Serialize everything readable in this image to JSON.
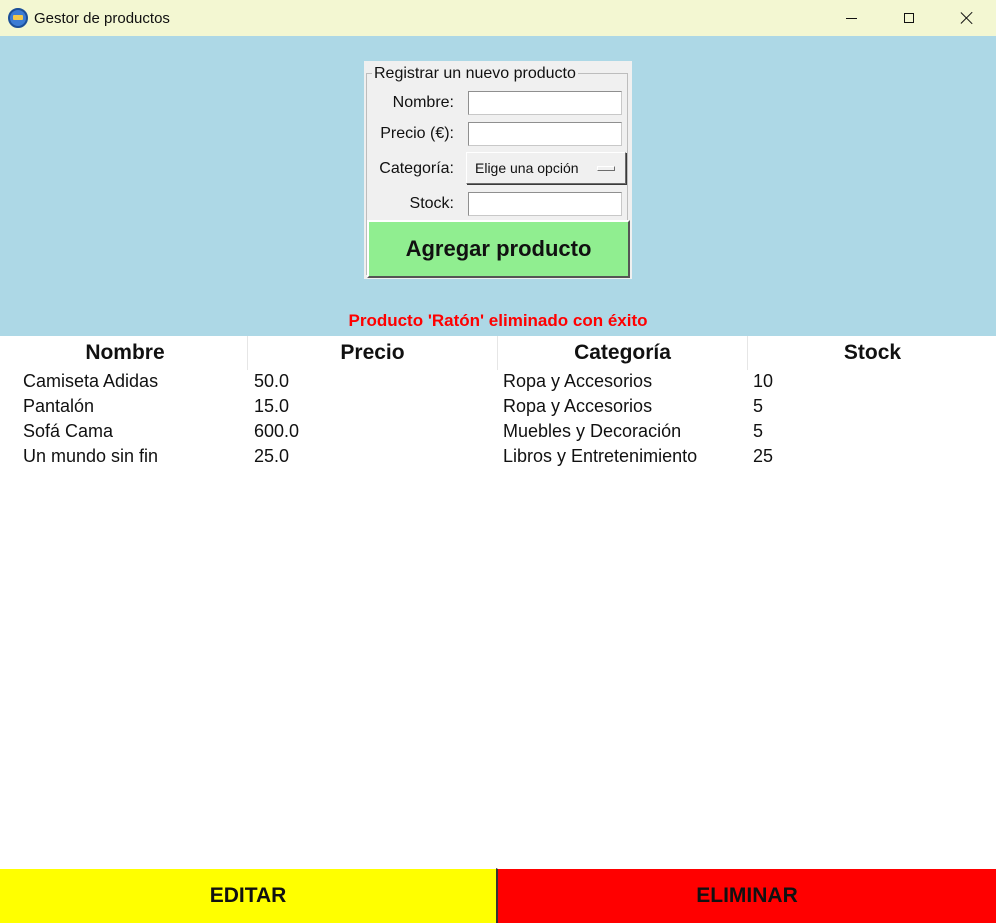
{
  "window": {
    "title": "Gestor de productos",
    "icon": "app-icon"
  },
  "form": {
    "legend": "Registrar un nuevo producto",
    "labels": {
      "nombre": "Nombre:",
      "precio": "Precio (€):",
      "categoria": "Categoría:",
      "stock": "Stock:"
    },
    "values": {
      "nombre": "",
      "precio": "",
      "stock": ""
    },
    "categoria_selected": "Elige una opción",
    "add_button": "Agregar producto"
  },
  "status": {
    "message": "Producto 'Ratón' eliminado con éxito",
    "color": "#ff0000"
  },
  "table": {
    "headers": [
      "Nombre",
      "Precio",
      "Categoría",
      "Stock"
    ],
    "rows": [
      [
        "Camiseta Adidas",
        "50.0",
        "Ropa y Accesorios",
        "10"
      ],
      [
        "Pantalón",
        "15.0",
        "Ropa y Accesorios",
        "5"
      ],
      [
        "Sofá Cama",
        "600.0",
        "Muebles y Decoración",
        "5"
      ],
      [
        "Un mundo sin fin",
        "25.0",
        "Libros y Entretenimiento",
        "25"
      ]
    ]
  },
  "actions": {
    "edit": "EDITAR",
    "delete": "ELIMINAR"
  },
  "colors": {
    "titlebar": "#f3f7d2",
    "panel": "#add8e6",
    "add_button": "#90ee90",
    "edit_button": "#ffff00",
    "delete_button": "#ff0000"
  }
}
